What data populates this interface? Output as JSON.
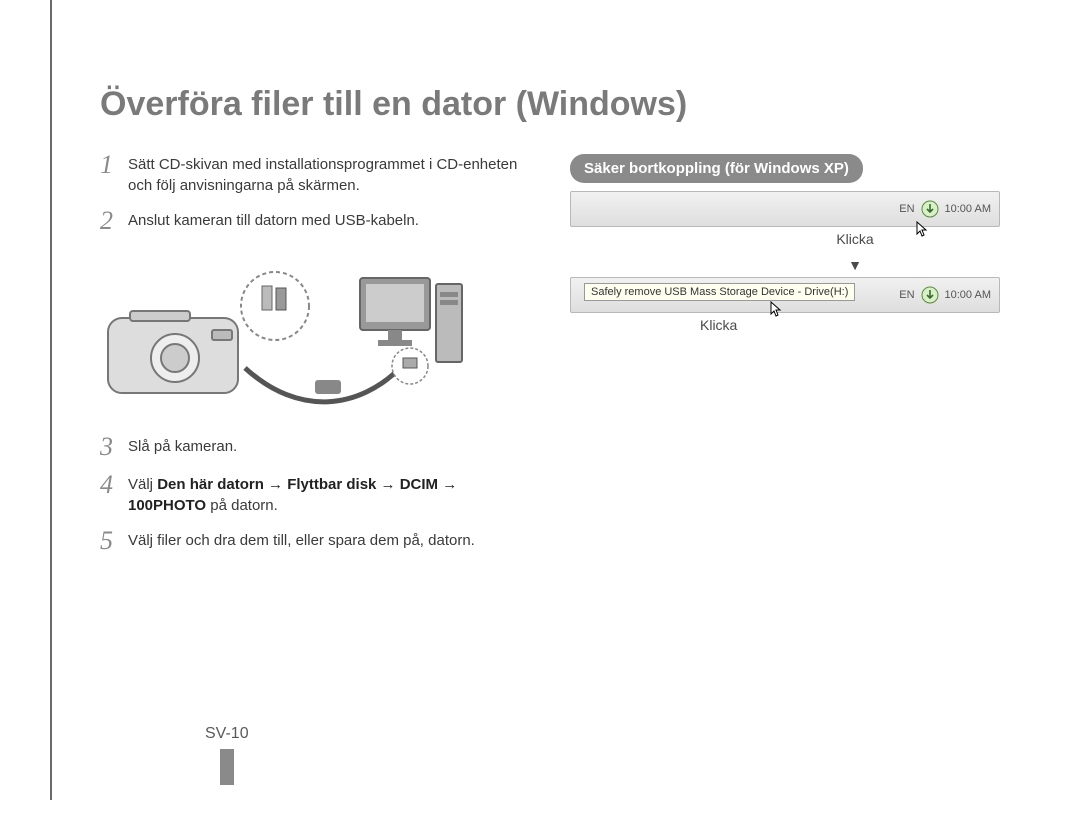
{
  "title": "Överföra filer till en dator (Windows)",
  "steps": {
    "s1": {
      "num": "1",
      "text": "Sätt CD-skivan med installationsprogrammet i CD-enheten och följ anvisningarna på skärmen."
    },
    "s2": {
      "num": "2",
      "text": "Anslut kameran till datorn med USB-kabeln."
    },
    "s3": {
      "num": "3",
      "text": "Slå på kameran."
    },
    "s4": {
      "num": "4",
      "text_pre": "Välj ",
      "text_bold": "Den här datorn → Flyttbar disk → DCIM → 100PHOTO",
      "text_post": " på datorn."
    },
    "s5": {
      "num": "5",
      "text": "Välj filer och dra dem till, eller spara dem på, datorn."
    }
  },
  "callout": {
    "title": "Säker bortkoppling (för Windows XP)",
    "tooltip": "Safely remove USB Mass Storage Device - Drive(H:)",
    "lang": "EN",
    "time": "10:00 AM",
    "click": "Klicka"
  },
  "pagenum": "SV-10"
}
